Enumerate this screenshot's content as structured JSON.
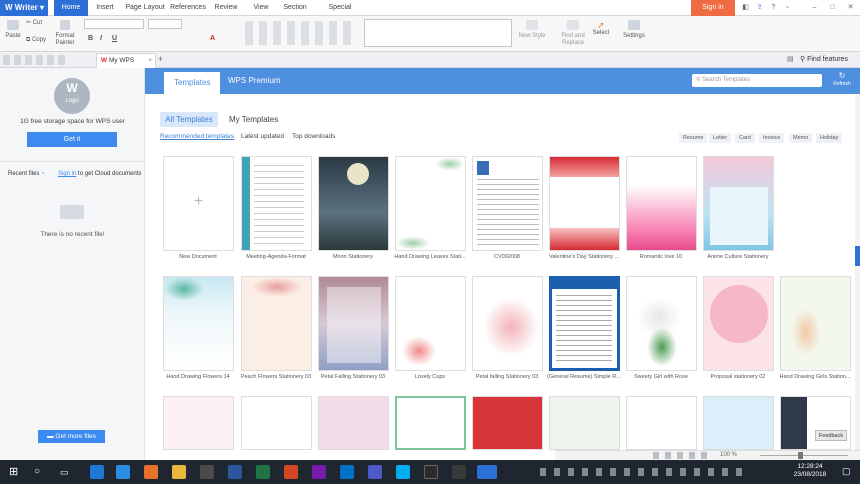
{
  "app": {
    "name": "Writer"
  },
  "menu_tabs": [
    "Home",
    "Insert",
    "Page Layout",
    "References",
    "Review",
    "View",
    "Section",
    "Special Features"
  ],
  "signin_label": "Sign in",
  "ribbon": {
    "paste": "Paste",
    "cut": "Cut",
    "copy": "Copy",
    "format_painter_1": "Format",
    "format_painter_2": "Painter",
    "new_style": "New Style",
    "find_replace_1": "Find and",
    "find_replace_2": "Replace",
    "select": "Select",
    "settings": "Settings",
    "bold": "B",
    "italic": "I",
    "underline": "U",
    "font_color": "A"
  },
  "doc_tab": {
    "label": "My WPS",
    "close": "×",
    "add": "+"
  },
  "find_features": "Find features",
  "left_panel": {
    "logo_text": "Logo",
    "storage_text": "1G free storage space for WPS user",
    "get_it": "Get it",
    "recent_label": "Recent files",
    "signin_link": "Sign in",
    "signin_rest": "to get Cloud documents",
    "no_recent": "There is no recent file!",
    "get_more": "Get more files"
  },
  "top_tabs": [
    "Templates",
    "WPS Premium"
  ],
  "search": {
    "placeholder": "Search Templates"
  },
  "refresh": "Refresh",
  "sub_tabs": [
    "All Templates",
    "My Templates"
  ],
  "filter_tabs": [
    "Recommended templates",
    "Latest updated",
    "Top downloads"
  ],
  "tags": [
    "Resume",
    "Letter",
    "Card",
    "Invoice",
    "Memo",
    "Holiday"
  ],
  "templates_row1": [
    "New Document",
    "Meeting-Agenda-Format",
    "Moon Stationery",
    "Hand Drawing Leaves Stati...",
    "CV092008",
    "Valentine's Day Stationery ...",
    "Romantic love 10",
    "Anime Culture Stationery"
  ],
  "templates_row2": [
    "Hand Drawing Flowers 14",
    "Peach Flowers Stationery 03",
    "Petal Falling Stationery 03",
    "Lovely Cups",
    "Petal falling Stationery 03",
    "(General Resume) Simple R...",
    "Sweety Girl with Rose",
    "Proposal stationery 02",
    "Hand Drawing Girls Station..."
  ],
  "status": {
    "zoom": "100 %"
  },
  "feedback": "Feedback",
  "clock": {
    "time": "12:28:24",
    "date": "23/08/2018"
  },
  "colors": {
    "brand_blue": "#2c6fd6",
    "template_blue": "#4f8fe0",
    "signin_orange": "#ef6b43",
    "taskbar": "#1f2630"
  }
}
